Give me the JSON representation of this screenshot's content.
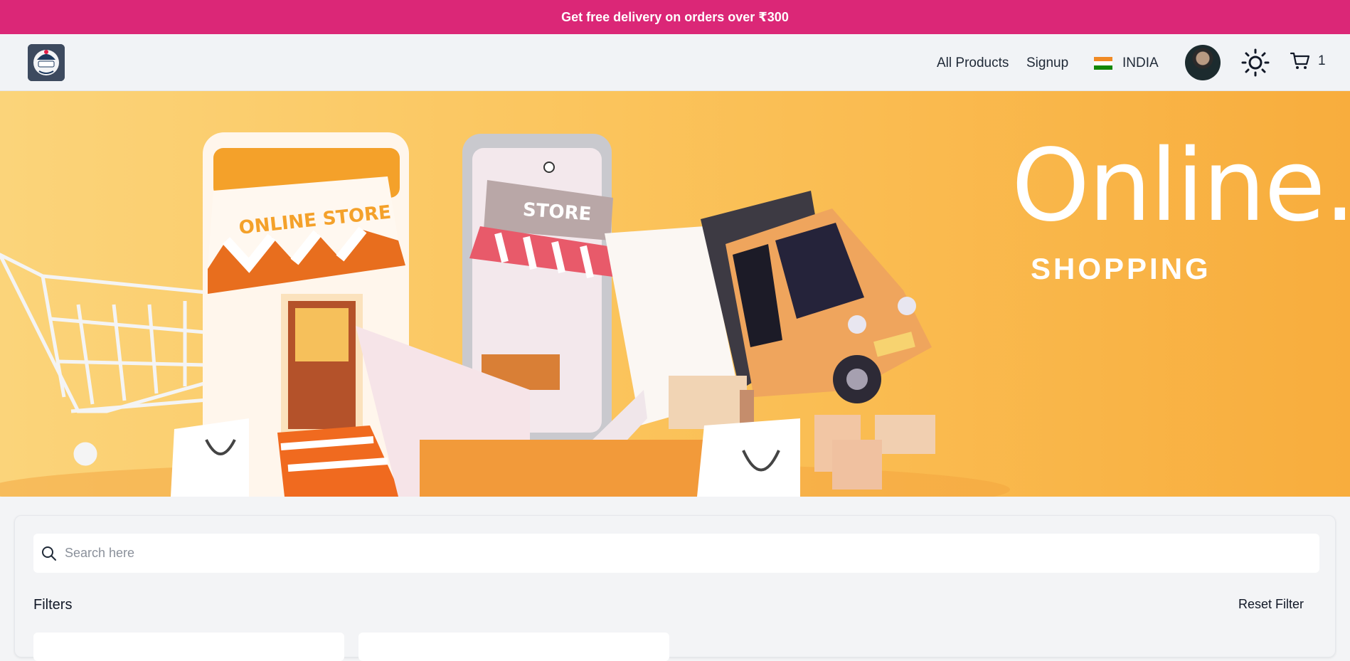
{
  "promo": {
    "text": "Get free delivery on orders over ₹300"
  },
  "nav": {
    "logo_icon": "dephub-logo",
    "links": [
      {
        "label": "All Products"
      },
      {
        "label": "Signup"
      }
    ],
    "country": {
      "label": "INDIA",
      "flag_icon": "india-flag-icon"
    },
    "avatar": "user-avatar",
    "theme_icon": "sun-icon",
    "cart": {
      "icon": "cart-icon",
      "count": "1"
    }
  },
  "hero": {
    "title": "Online.",
    "subtitle": "SHOPPING",
    "illustration_store_sign": "ONLINE STORE",
    "illustration_phone_sign": "STORE",
    "colors": {
      "bg_start": "#fbd47a",
      "bg_end": "#f8ad3d"
    }
  },
  "filters": {
    "search_placeholder": "Search here",
    "search_value": "",
    "title": "Filters",
    "reset_label": "Reset Filter"
  },
  "colors": {
    "promo_bg": "#db2777",
    "nav_bg": "#f1f3f6",
    "panel_bg": "#f3f4f6"
  }
}
